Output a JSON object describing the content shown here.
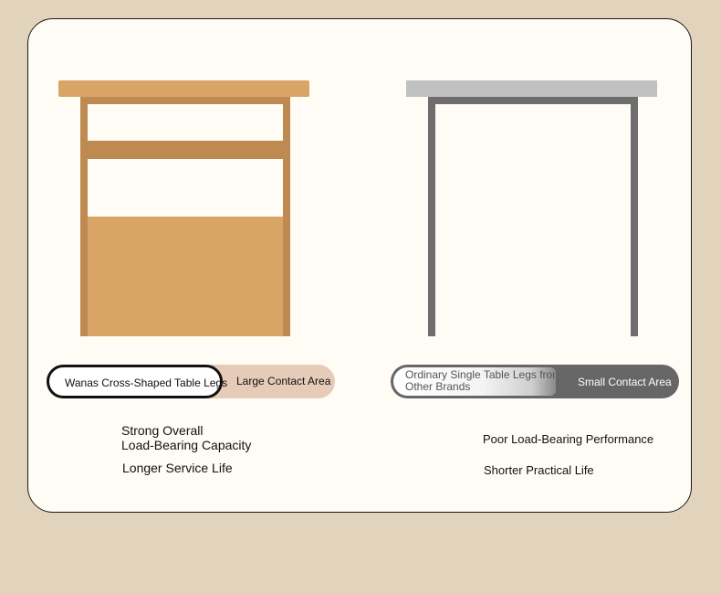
{
  "left_product": {
    "name_pill": "Wanas Cross-Shaped Table Legs",
    "contact_label": "Large Contact Area",
    "benefits": [
      "Strong Overall",
      "Load-Bearing Capacity",
      "Longer Service Life"
    ],
    "colors": {
      "tabletop": "#d9a566",
      "frame": "#bf8a52",
      "pill_bg": "#e6cbb8"
    }
  },
  "right_product": {
    "name_pill_line1": "Ordinary Single Table Legs from",
    "name_pill_line2": "Other Brands",
    "contact_label": "Small Contact Area",
    "drawbacks": [
      "Poor Load-Bearing Performance",
      "Shorter Practical Life"
    ],
    "colors": {
      "tabletop": "#c0c0c0",
      "frame": "#6e6e6e",
      "pill_bg": "#666666"
    }
  }
}
